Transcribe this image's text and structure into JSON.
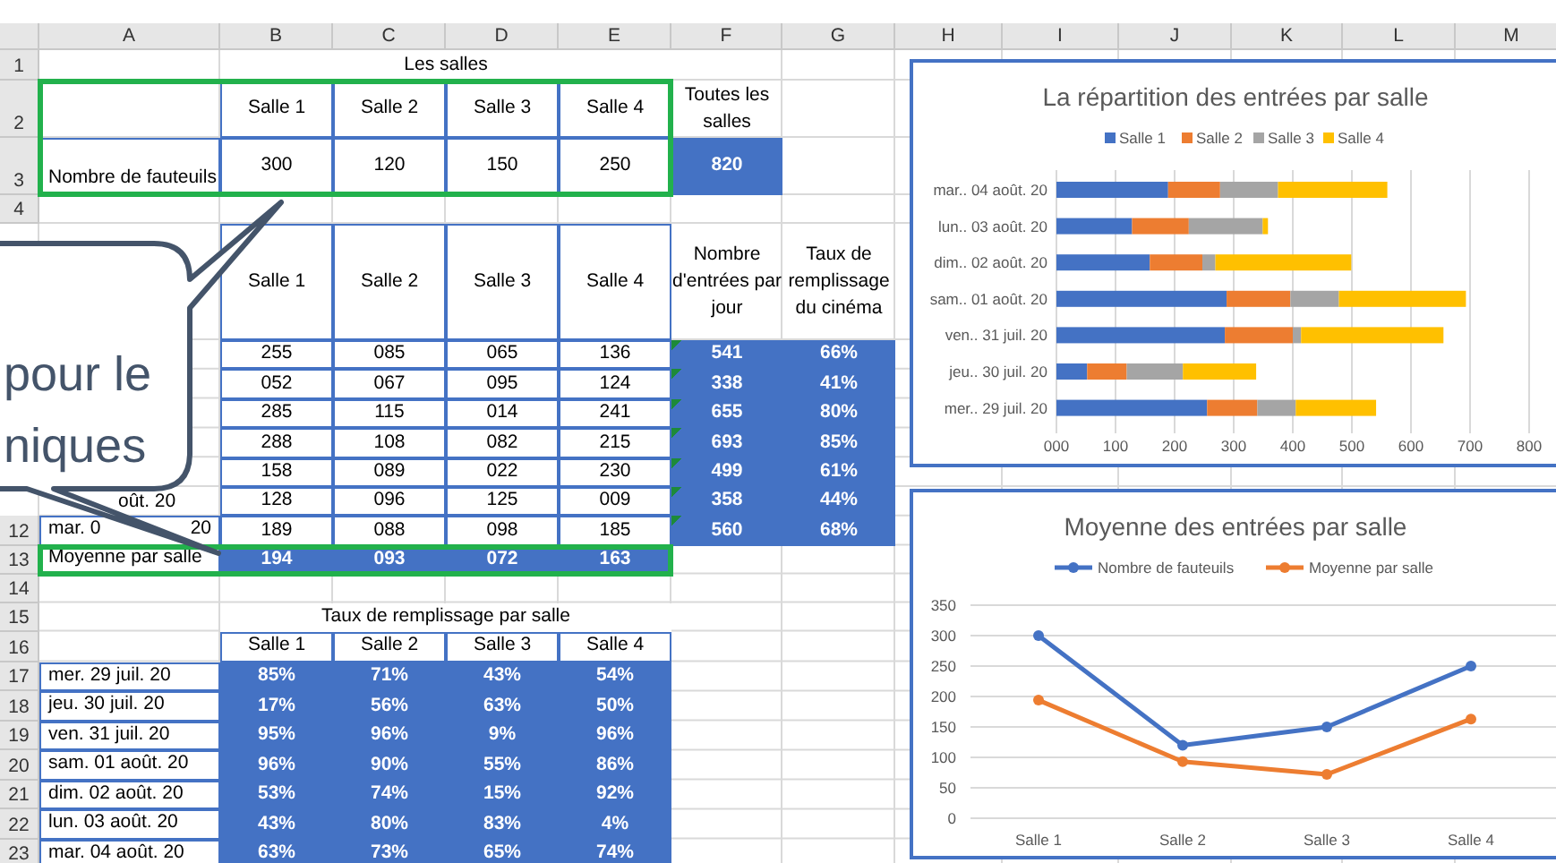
{
  "sheet": {
    "columns": [
      "A",
      "B",
      "C",
      "D",
      "E",
      "F",
      "G",
      "H",
      "I",
      "J",
      "K",
      "L",
      "M"
    ],
    "rows": [
      {
        "number": "1",
        "outlined": false,
        "cells": [
          {
            "kind": "empty"
          },
          {
            "kind": "title",
            "text": "Les salles"
          }
        ]
      },
      {
        "number": "2",
        "outlined": true,
        "cells": [
          {
            "kind": "empty"
          },
          {
            "kind": "header",
            "text": "Salle 1"
          },
          {
            "kind": "header",
            "text": "Salle 2"
          },
          {
            "kind": "header",
            "text": "Salle 3"
          },
          {
            "kind": "header",
            "text": "Salle 4"
          },
          {
            "kind": "note",
            "text": "Toutes les salles"
          }
        ]
      },
      {
        "number": "3",
        "outlined": true,
        "cells": [
          {
            "kind": "label",
            "text": "Nombre de fauteuils"
          },
          {
            "kind": "value",
            "text": "300"
          },
          {
            "kind": "value",
            "text": "120"
          },
          {
            "kind": "value",
            "text": "150"
          },
          {
            "kind": "value",
            "text": "250"
          },
          {
            "kind": "filled",
            "text": "820"
          }
        ]
      },
      {
        "number": "4",
        "outlined": false,
        "cells": []
      },
      {
        "outlined": false,
        "cells": [
          {
            "kind": "empty"
          },
          {
            "kind": "header",
            "text": "Salle 1"
          },
          {
            "kind": "header",
            "text": "Salle 2"
          },
          {
            "kind": "header",
            "text": "Salle 3"
          },
          {
            "kind": "header",
            "text": "Salle 4"
          },
          {
            "kind": "note",
            "text": "Nombre d'entrées par jour"
          },
          {
            "kind": "note",
            "text": "Taux de remplissage du cinéma"
          }
        ]
      },
      {
        "outlined": false,
        "cells": [
          {
            "kind": "empty"
          },
          {
            "kind": "value",
            "text": "255"
          },
          {
            "kind": "value",
            "text": "085"
          },
          {
            "kind": "value",
            "text": "065"
          },
          {
            "kind": "value",
            "text": "136"
          },
          {
            "kind": "flagged",
            "text": "541"
          },
          {
            "kind": "filled",
            "text": "66%"
          }
        ]
      },
      {
        "outlined": false,
        "cells": [
          {
            "kind": "empty"
          },
          {
            "kind": "value",
            "text": "052"
          },
          {
            "kind": "value",
            "text": "067"
          },
          {
            "kind": "value",
            "text": "095"
          },
          {
            "kind": "value",
            "text": "124"
          },
          {
            "kind": "flagged",
            "text": "338"
          },
          {
            "kind": "filled",
            "text": "41%"
          }
        ]
      },
      {
        "outlined": false,
        "cells": [
          {
            "kind": "empty"
          },
          {
            "kind": "value",
            "text": "285"
          },
          {
            "kind": "value",
            "text": "115"
          },
          {
            "kind": "value",
            "text": "014"
          },
          {
            "kind": "value",
            "text": "241"
          },
          {
            "kind": "flagged",
            "text": "655"
          },
          {
            "kind": "filled",
            "text": "80%"
          }
        ]
      },
      {
        "outlined": false,
        "cells": [
          {
            "kind": "empty"
          },
          {
            "kind": "value",
            "text": "288"
          },
          {
            "kind": "value",
            "text": "108"
          },
          {
            "kind": "value",
            "text": "082"
          },
          {
            "kind": "value",
            "text": "215"
          },
          {
            "kind": "flagged",
            "text": "693"
          },
          {
            "kind": "filled",
            "text": "85%"
          }
        ]
      },
      {
        "outlined": false,
        "cells": [
          {
            "kind": "empty"
          },
          {
            "kind": "value",
            "text": "158"
          },
          {
            "kind": "value",
            "text": "089"
          },
          {
            "kind": "value",
            "text": "022"
          },
          {
            "kind": "value",
            "text": "230"
          },
          {
            "kind": "flagged",
            "text": "499"
          },
          {
            "kind": "filled",
            "text": "61%"
          }
        ]
      },
      {
        "outlined": false,
        "cells": [
          {
            "kind": "partial",
            "text": "oût. 20"
          },
          {
            "kind": "value",
            "text": "128"
          },
          {
            "kind": "value",
            "text": "096"
          },
          {
            "kind": "value",
            "text": "125"
          },
          {
            "kind": "value",
            "text": "009"
          },
          {
            "kind": "flagged",
            "text": "358"
          },
          {
            "kind": "filled",
            "text": "44%"
          }
        ]
      },
      {
        "number": "12",
        "outlined": false,
        "cells": [
          {
            "kind": "split",
            "parts": [
              "mar. 0",
              "20"
            ]
          },
          {
            "kind": "value",
            "text": "189"
          },
          {
            "kind": "value",
            "text": "088"
          },
          {
            "kind": "value",
            "text": "098"
          },
          {
            "kind": "value",
            "text": "185"
          },
          {
            "kind": "flagged",
            "text": "560"
          },
          {
            "kind": "filled",
            "text": "68%"
          }
        ]
      },
      {
        "number": "13",
        "outlined": true,
        "cells": [
          {
            "kind": "label",
            "text": "Moyenne par salle"
          },
          {
            "kind": "filled",
            "text": "194"
          },
          {
            "kind": "filled",
            "text": "093"
          },
          {
            "kind": "filled",
            "text": "072"
          },
          {
            "kind": "filled",
            "text": "163"
          }
        ]
      },
      {
        "number": "14",
        "outlined": false,
        "cells": []
      },
      {
        "number": "15",
        "outlined": false,
        "cells": [
          {
            "kind": "empty"
          },
          {
            "kind": "title",
            "text": "Taux de remplissage par salle"
          }
        ]
      },
      {
        "number": "16",
        "outlined": false,
        "cells": [
          {
            "kind": "empty"
          },
          {
            "kind": "header",
            "text": "Salle 1"
          },
          {
            "kind": "header",
            "text": "Salle 2"
          },
          {
            "kind": "header",
            "text": "Salle 3"
          },
          {
            "kind": "header",
            "text": "Salle 4"
          }
        ]
      },
      {
        "number": "17",
        "outlined": false,
        "cells": [
          {
            "kind": "label",
            "text": "mer. 29 juil. 20"
          },
          {
            "kind": "filled",
            "text": "85%"
          },
          {
            "kind": "filled",
            "text": "71%"
          },
          {
            "kind": "filled",
            "text": "43%"
          },
          {
            "kind": "filled",
            "text": "54%"
          }
        ]
      },
      {
        "number": "18",
        "outlined": false,
        "cells": [
          {
            "kind": "label",
            "text": "jeu. 30 juil. 20"
          },
          {
            "kind": "filled",
            "text": "17%"
          },
          {
            "kind": "filled",
            "text": "56%"
          },
          {
            "kind": "filled",
            "text": "63%"
          },
          {
            "kind": "filled",
            "text": "50%"
          }
        ]
      },
      {
        "number": "19",
        "outlined": false,
        "cells": [
          {
            "kind": "label",
            "text": "ven. 31 juil. 20"
          },
          {
            "kind": "filled",
            "text": "95%"
          },
          {
            "kind": "filled",
            "text": "96%"
          },
          {
            "kind": "filled",
            "text": "9%"
          },
          {
            "kind": "filled",
            "text": "96%"
          }
        ]
      },
      {
        "number": "20",
        "outlined": false,
        "cells": [
          {
            "kind": "label",
            "text": "sam. 01 août. 20"
          },
          {
            "kind": "filled",
            "text": "96%"
          },
          {
            "kind": "filled",
            "text": "90%"
          },
          {
            "kind": "filled",
            "text": "55%"
          },
          {
            "kind": "filled",
            "text": "86%"
          }
        ]
      },
      {
        "number": "21",
        "outlined": false,
        "cells": [
          {
            "kind": "label",
            "text": "dim. 02 août. 20"
          },
          {
            "kind": "filled",
            "text": "53%"
          },
          {
            "kind": "filled",
            "text": "74%"
          },
          {
            "kind": "filled",
            "text": "15%"
          },
          {
            "kind": "filled",
            "text": "92%"
          }
        ]
      },
      {
        "number": "22",
        "outlined": false,
        "cells": [
          {
            "kind": "label",
            "text": "lun. 03 août. 20"
          },
          {
            "kind": "filled",
            "text": "43%"
          },
          {
            "kind": "filled",
            "text": "80%"
          },
          {
            "kind": "filled",
            "text": "83%"
          },
          {
            "kind": "filled",
            "text": "4%"
          }
        ]
      },
      {
        "number": "23",
        "outlined": false,
        "cells": [
          {
            "kind": "label",
            "text": "mar. 04 août. 20"
          },
          {
            "kind": "filled",
            "text": "63%"
          },
          {
            "kind": "filled",
            "text": "73%"
          },
          {
            "kind": "filled",
            "text": "65%"
          },
          {
            "kind": "filled",
            "text": "74%"
          }
        ]
      }
    ]
  },
  "callout": {
    "lines": [
      "pour le",
      "niques"
    ]
  },
  "charts": [
    {
      "chart_data": {
        "type": "bar",
        "orientation": "horizontal",
        "stacked": true,
        "title": "La répartition des entrées par salle",
        "grid": true,
        "legend": true,
        "categories": [
          "mar.. 04 août. 20",
          "lun.. 03 août. 20",
          "dim.. 02 août. 20",
          "sam.. 01 août. 20",
          "ven.. 31 juil. 20",
          "jeu.. 30 juil. 20",
          "mer.. 29 juil. 20"
        ],
        "series": [
          {
            "name": "Salle 1",
            "color": "#4472c4",
            "values": [
              189,
              128,
              158,
              288,
              285,
              52,
              255
            ]
          },
          {
            "name": "Salle 2",
            "color": "#ed7d31",
            "values": [
              88,
              96,
              89,
              108,
              115,
              67,
              85
            ]
          },
          {
            "name": "Salle 3",
            "color": "#a5a5a5",
            "values": [
              98,
              125,
              22,
              82,
              14,
              95,
              65
            ]
          },
          {
            "name": "Salle 4",
            "color": "#ffc000",
            "values": [
              185,
              9,
              230,
              215,
              241,
              124,
              136
            ]
          }
        ],
        "xlim": [
          0,
          800
        ],
        "xticks": [
          {
            "value": 0,
            "label": "000"
          },
          {
            "value": 100,
            "label": "100"
          },
          {
            "value": 200,
            "label": "200"
          },
          {
            "value": 300,
            "label": "300"
          },
          {
            "value": 400,
            "label": "400"
          },
          {
            "value": 500,
            "label": "500"
          },
          {
            "value": 600,
            "label": "600"
          },
          {
            "value": 700,
            "label": "700"
          },
          {
            "value": 800,
            "label": "800"
          }
        ]
      }
    },
    {
      "chart_data": {
        "type": "line",
        "title": "Moyenne des entrées par salle",
        "grid": true,
        "legend": true,
        "categories": [
          "Salle 1",
          "Salle 2",
          "Salle 3",
          "Salle 4"
        ],
        "series": [
          {
            "name": "Nombre de fauteuils",
            "color": "#4472c4",
            "marker": "circle",
            "values": [
              300,
              120,
              150,
              250
            ]
          },
          {
            "name": "Moyenne par salle",
            "color": "#ed7d31",
            "marker": "circle",
            "values": [
              194,
              93,
              72,
              163
            ]
          }
        ],
        "ylim": [
          0,
          350
        ],
        "yticks": [
          0,
          50,
          100,
          150,
          200,
          250,
          300,
          350
        ]
      }
    }
  ]
}
